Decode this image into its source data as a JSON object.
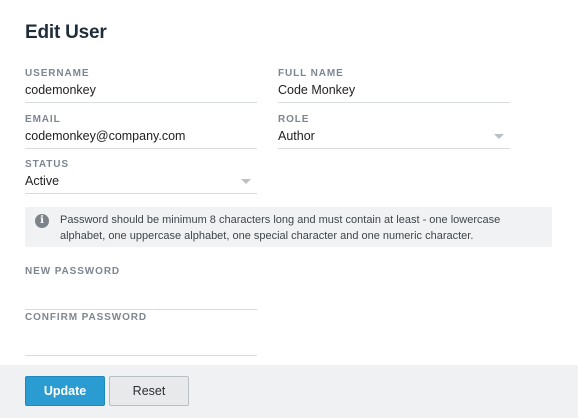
{
  "page": {
    "title": "Edit User"
  },
  "form": {
    "username": {
      "label": "USERNAME",
      "value": "codemonkey"
    },
    "full_name": {
      "label": "FULL NAME",
      "value": "Code Monkey"
    },
    "email": {
      "label": "EMAIL",
      "value": "codemonkey@company.com"
    },
    "role": {
      "label": "ROLE",
      "value": "Author"
    },
    "status": {
      "label": "STATUS",
      "value": "Active"
    },
    "new_password": {
      "label": "NEW PASSWORD",
      "value": ""
    },
    "confirm_password": {
      "label": "CONFIRM PASSWORD",
      "value": ""
    }
  },
  "info": {
    "icon": "info-icon",
    "text": "Password should be minimum 8 characters long and must contain at least  - one lowercase alphabet, one uppercase alphabet, one special character and one numeric character."
  },
  "footer": {
    "update_label": "Update",
    "reset_label": "Reset"
  },
  "colors": {
    "accent": "#2a9cd1",
    "footer_bg": "#eff1f2",
    "info_bg": "#f1f2f3"
  }
}
